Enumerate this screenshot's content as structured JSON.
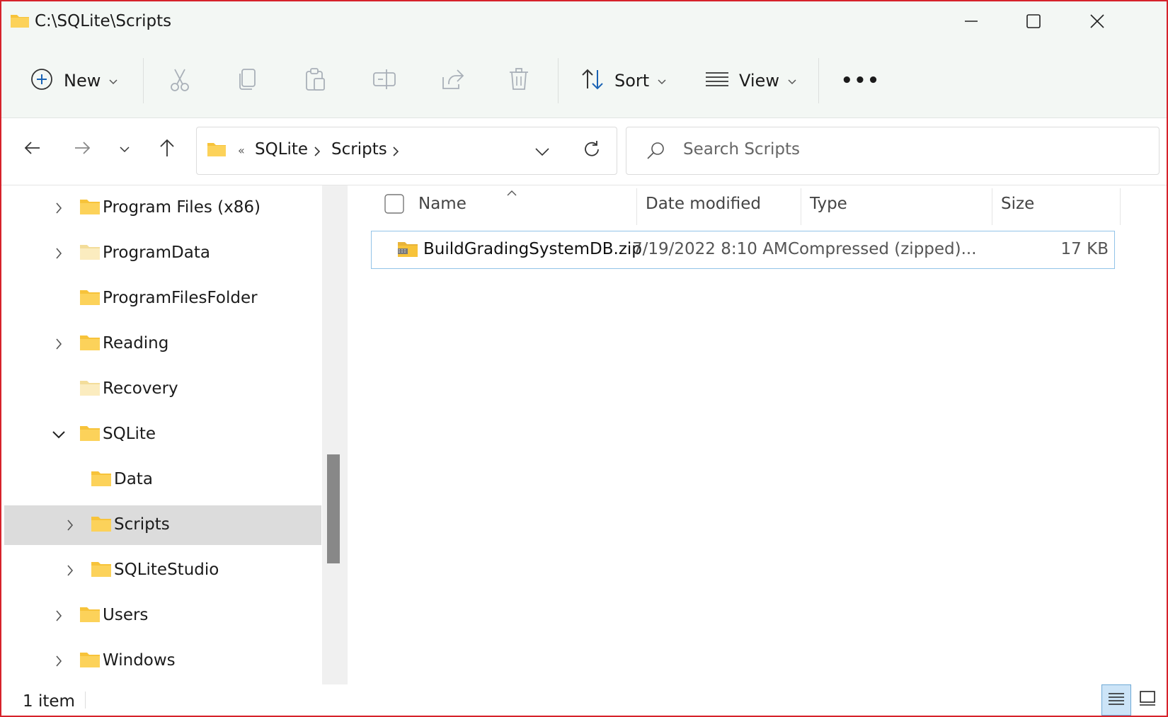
{
  "window": {
    "title": "C:\\SQLite\\Scripts",
    "controls": {
      "minimize": "minimize-icon",
      "maximize": "maximize-icon",
      "close": "close-icon"
    }
  },
  "toolbar": {
    "new_label": "New",
    "sort_label": "Sort",
    "view_label": "View",
    "more_label": "•••",
    "icons": [
      "plus-circle-icon",
      "cut-icon",
      "copy-icon",
      "paste-icon",
      "rename-icon",
      "share-icon",
      "delete-icon",
      "sort-icon",
      "view-lines-icon"
    ]
  },
  "navigation": {
    "breadcrumb_overflow": "«",
    "breadcrumbs": [
      "SQLite",
      "Scripts"
    ],
    "search_placeholder": "Search Scripts"
  },
  "tree": [
    {
      "label": "Program Files (x86)",
      "chevron": "right",
      "level": 1,
      "pale": false,
      "selected": false
    },
    {
      "label": "ProgramData",
      "chevron": "right",
      "level": 1,
      "pale": true,
      "selected": false
    },
    {
      "label": "ProgramFilesFolder",
      "chevron": "none",
      "level": 1,
      "pale": false,
      "selected": false
    },
    {
      "label": "Reading",
      "chevron": "right",
      "level": 1,
      "pale": false,
      "selected": false
    },
    {
      "label": "Recovery",
      "chevron": "none",
      "level": 1,
      "pale": true,
      "selected": false
    },
    {
      "label": "SQLite",
      "chevron": "down",
      "level": 1,
      "pale": false,
      "selected": false
    },
    {
      "label": "Data",
      "chevron": "none",
      "level": 2,
      "pale": false,
      "selected": false
    },
    {
      "label": "Scripts",
      "chevron": "right",
      "level": 2,
      "pale": false,
      "selected": true
    },
    {
      "label": "SQLiteStudio",
      "chevron": "right",
      "level": 2,
      "pale": false,
      "selected": false
    },
    {
      "label": "Users",
      "chevron": "right",
      "level": 1,
      "pale": false,
      "selected": false
    },
    {
      "label": "Windows",
      "chevron": "right",
      "level": 1,
      "pale": false,
      "selected": false
    }
  ],
  "file_list": {
    "columns": [
      "Name",
      "Date modified",
      "Type",
      "Size"
    ],
    "rows": [
      {
        "name": "BuildGradingSystemDB.zip",
        "date_modified": "7/19/2022 8:10 AM",
        "type": "Compressed (zipped)...",
        "size": "17 KB"
      }
    ]
  },
  "status": {
    "item_count": "1 item"
  },
  "colors": {
    "window_border": "#d6222b",
    "selection": "#dcdcdc",
    "row_border": "#92c3e8",
    "folder": "#f7c33a"
  }
}
